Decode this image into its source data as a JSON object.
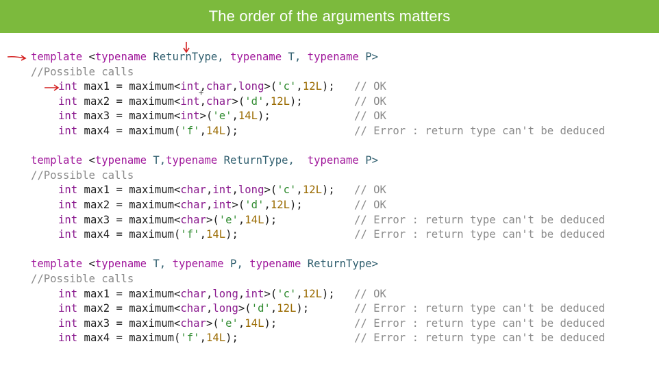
{
  "slide": {
    "title": "The order of the arguments matters"
  },
  "blocks": [
    {
      "template": [
        "template <",
        "typename",
        " ReturnType, ",
        "typename",
        " T, ",
        "typename",
        " P>"
      ],
      "comment": "//Possible calls",
      "calls": [
        {
          "ret": "int",
          "name": " max1 = maximum<",
          "targs": [
            "int",
            "char",
            "long"
          ],
          "args": [
            "'c'",
            "12L"
          ],
          "close": ">(",
          "end": ");",
          "comment": "// OK"
        },
        {
          "ret": "int",
          "name": " max2 = maximum<",
          "targs": [
            "int",
            "char"
          ],
          "args": [
            "'d'",
            "12L"
          ],
          "close": ">(",
          "end": ");",
          "comment": "// OK"
        },
        {
          "ret": "int",
          "name": " max3 = maximum<",
          "targs": [
            "int"
          ],
          "args": [
            "'e'",
            "14L"
          ],
          "close": ">(",
          "end": ");",
          "comment": "// OK"
        },
        {
          "ret": "int",
          "name": " max4 = maximum(",
          "targs": [],
          "args": [
            "'f'",
            "14L"
          ],
          "close": "",
          "end": ");",
          "comment": "// Error : return type can't be deduced"
        }
      ]
    },
    {
      "template": [
        "template <",
        "typename",
        " T,",
        "typename",
        " ReturnType,  ",
        "typename",
        " P>"
      ],
      "comment": "//Possible calls",
      "calls": [
        {
          "ret": "int",
          "name": " max1 = maximum<",
          "targs": [
            "char",
            "int",
            "long"
          ],
          "args": [
            "'c'",
            "12L"
          ],
          "close": ">(",
          "end": ");",
          "comment": "// OK"
        },
        {
          "ret": "int",
          "name": " max2 = maximum<",
          "targs": [
            "char",
            "int"
          ],
          "args": [
            "'d'",
            "12L"
          ],
          "close": ">(",
          "end": ");",
          "comment": "// OK"
        },
        {
          "ret": "int",
          "name": " max3 = maximum<",
          "targs": [
            "char"
          ],
          "args": [
            "'e'",
            "14L"
          ],
          "close": ">(",
          "end": ");",
          "comment": "// Error : return type can't be deduced"
        },
        {
          "ret": "int",
          "name": " max4 = maximum(",
          "targs": [],
          "args": [
            "'f'",
            "14L"
          ],
          "close": "",
          "end": ");",
          "comment": "// Error : return type can't be deduced"
        }
      ]
    },
    {
      "template": [
        "template <",
        "typename",
        " T, ",
        "typename",
        " P, ",
        "typename",
        " ReturnType>"
      ],
      "comment": "//Possible calls",
      "calls": [
        {
          "ret": "int",
          "name": " max1 = maximum<",
          "targs": [
            "char",
            "long",
            "int"
          ],
          "args": [
            "'c'",
            "12L"
          ],
          "close": ">(",
          "end": ");",
          "comment": "// OK"
        },
        {
          "ret": "int",
          "name": " max2 = maximum<",
          "targs": [
            "char",
            "long"
          ],
          "args": [
            "'d'",
            "12L"
          ],
          "close": ">(",
          "end": ");",
          "comment": "// Error : return type can't be deduced"
        },
        {
          "ret": "int",
          "name": " max3 = maximum<",
          "targs": [
            "char"
          ],
          "args": [
            "'e'",
            "14L"
          ],
          "close": ">(",
          "end": ");",
          "comment": "// Error : return type can't be deduced"
        },
        {
          "ret": "int",
          "name": " max4 = maximum(",
          "targs": [],
          "args": [
            "'f'",
            "14L"
          ],
          "close": "",
          "end": ");",
          "comment": "// Error : return type can't be deduced"
        }
      ]
    }
  ],
  "colors": {
    "title_bar": "#7cba3d",
    "keyword": "#a0179b",
    "comment": "#8a8a8a",
    "string": "#2e8a2e",
    "number": "#9a6a00",
    "annotation_arrow": "#d42020"
  },
  "annotations": {
    "arrow_icons": [
      "right-arrow-icon",
      "right-arrow-icon",
      "down-arrow-icon"
    ]
  }
}
